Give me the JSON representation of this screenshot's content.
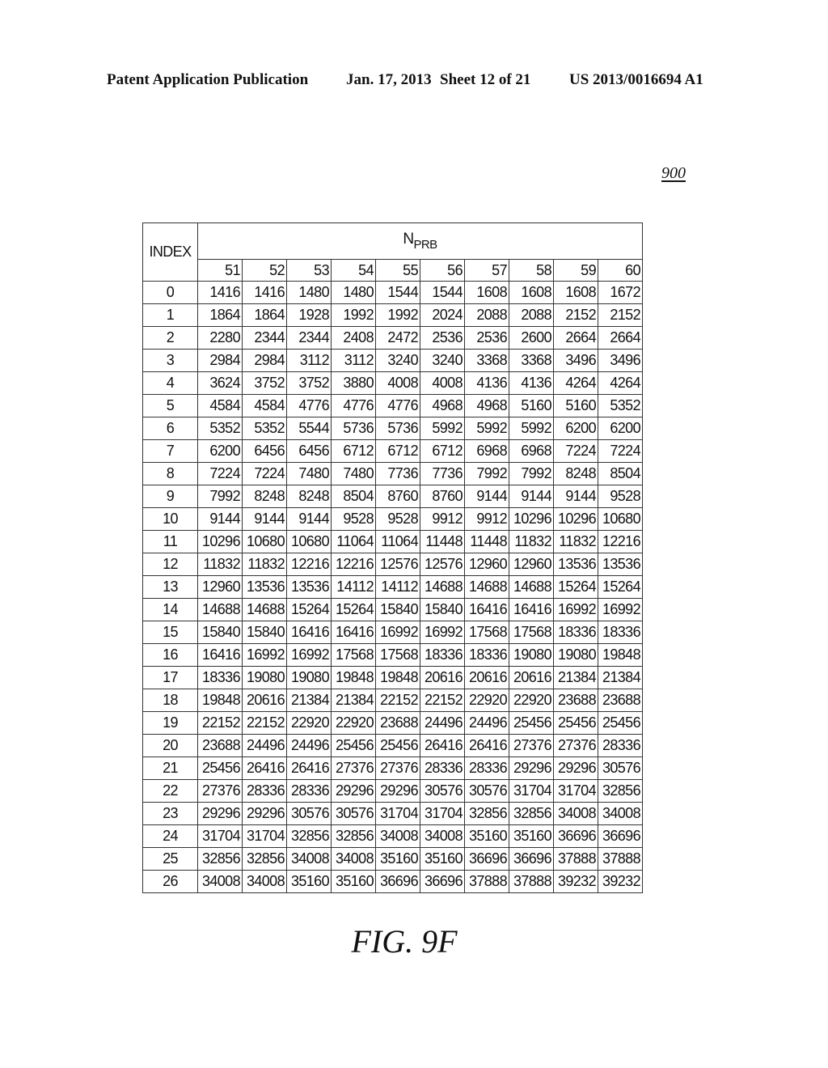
{
  "header": {
    "publication": "Patent Application Publication",
    "date": "Jan. 17, 2013",
    "sheet": "Sheet 12 of 21",
    "number": "US 2013/0016694 A1"
  },
  "figure_ref": "900",
  "table": {
    "index_label": "INDEX",
    "group_label_main": "N",
    "group_label_sub": "PRB",
    "columns": [
      "51",
      "52",
      "53",
      "54",
      "55",
      "56",
      "57",
      "58",
      "59",
      "60"
    ],
    "rows": [
      {
        "index": "0",
        "values": [
          "1416",
          "1416",
          "1480",
          "1480",
          "1544",
          "1544",
          "1608",
          "1608",
          "1608",
          "1672"
        ]
      },
      {
        "index": "1",
        "values": [
          "1864",
          "1864",
          "1928",
          "1992",
          "1992",
          "2024",
          "2088",
          "2088",
          "2152",
          "2152"
        ]
      },
      {
        "index": "2",
        "values": [
          "2280",
          "2344",
          "2344",
          "2408",
          "2472",
          "2536",
          "2536",
          "2600",
          "2664",
          "2664"
        ]
      },
      {
        "index": "3",
        "values": [
          "2984",
          "2984",
          "3112",
          "3112",
          "3240",
          "3240",
          "3368",
          "3368",
          "3496",
          "3496"
        ]
      },
      {
        "index": "4",
        "values": [
          "3624",
          "3752",
          "3752",
          "3880",
          "4008",
          "4008",
          "4136",
          "4136",
          "4264",
          "4264"
        ]
      },
      {
        "index": "5",
        "values": [
          "4584",
          "4584",
          "4776",
          "4776",
          "4776",
          "4968",
          "4968",
          "5160",
          "5160",
          "5352"
        ]
      },
      {
        "index": "6",
        "values": [
          "5352",
          "5352",
          "5544",
          "5736",
          "5736",
          "5992",
          "5992",
          "5992",
          "6200",
          "6200"
        ]
      },
      {
        "index": "7",
        "values": [
          "6200",
          "6456",
          "6456",
          "6712",
          "6712",
          "6712",
          "6968",
          "6968",
          "7224",
          "7224"
        ]
      },
      {
        "index": "8",
        "values": [
          "7224",
          "7224",
          "7480",
          "7480",
          "7736",
          "7736",
          "7992",
          "7992",
          "8248",
          "8504"
        ]
      },
      {
        "index": "9",
        "values": [
          "7992",
          "8248",
          "8248",
          "8504",
          "8760",
          "8760",
          "9144",
          "9144",
          "9144",
          "9528"
        ]
      },
      {
        "index": "10",
        "values": [
          "9144",
          "9144",
          "9144",
          "9528",
          "9528",
          "9912",
          "9912",
          "10296",
          "10296",
          "10680"
        ]
      },
      {
        "index": "11",
        "values": [
          "10296",
          "10680",
          "10680",
          "11064",
          "11064",
          "11448",
          "11448",
          "11832",
          "11832",
          "12216"
        ]
      },
      {
        "index": "12",
        "values": [
          "11832",
          "11832",
          "12216",
          "12216",
          "12576",
          "12576",
          "12960",
          "12960",
          "13536",
          "13536"
        ]
      },
      {
        "index": "13",
        "values": [
          "12960",
          "13536",
          "13536",
          "14112",
          "14112",
          "14688",
          "14688",
          "14688",
          "15264",
          "15264"
        ]
      },
      {
        "index": "14",
        "values": [
          "14688",
          "14688",
          "15264",
          "15264",
          "15840",
          "15840",
          "16416",
          "16416",
          "16992",
          "16992"
        ]
      },
      {
        "index": "15",
        "values": [
          "15840",
          "15840",
          "16416",
          "16416",
          "16992",
          "16992",
          "17568",
          "17568",
          "18336",
          "18336"
        ]
      },
      {
        "index": "16",
        "values": [
          "16416",
          "16992",
          "16992",
          "17568",
          "17568",
          "18336",
          "18336",
          "19080",
          "19080",
          "19848"
        ]
      },
      {
        "index": "17",
        "values": [
          "18336",
          "19080",
          "19080",
          "19848",
          "19848",
          "20616",
          "20616",
          "20616",
          "21384",
          "21384"
        ]
      },
      {
        "index": "18",
        "values": [
          "19848",
          "20616",
          "21384",
          "21384",
          "22152",
          "22152",
          "22920",
          "22920",
          "23688",
          "23688"
        ]
      },
      {
        "index": "19",
        "values": [
          "22152",
          "22152",
          "22920",
          "22920",
          "23688",
          "24496",
          "24496",
          "25456",
          "25456",
          "25456"
        ]
      },
      {
        "index": "20",
        "values": [
          "23688",
          "24496",
          "24496",
          "25456",
          "25456",
          "26416",
          "26416",
          "27376",
          "27376",
          "28336"
        ]
      },
      {
        "index": "21",
        "values": [
          "25456",
          "26416",
          "26416",
          "27376",
          "27376",
          "28336",
          "28336",
          "29296",
          "29296",
          "30576"
        ]
      },
      {
        "index": "22",
        "values": [
          "27376",
          "28336",
          "28336",
          "29296",
          "29296",
          "30576",
          "30576",
          "31704",
          "31704",
          "32856"
        ]
      },
      {
        "index": "23",
        "values": [
          "29296",
          "29296",
          "30576",
          "30576",
          "31704",
          "31704",
          "32856",
          "32856",
          "34008",
          "34008"
        ]
      },
      {
        "index": "24",
        "values": [
          "31704",
          "31704",
          "32856",
          "32856",
          "34008",
          "34008",
          "35160",
          "35160",
          "36696",
          "36696"
        ]
      },
      {
        "index": "25",
        "values": [
          "32856",
          "32856",
          "34008",
          "34008",
          "35160",
          "35160",
          "36696",
          "36696",
          "37888",
          "37888"
        ]
      },
      {
        "index": "26",
        "values": [
          "34008",
          "34008",
          "35160",
          "35160",
          "36696",
          "36696",
          "37888",
          "37888",
          "39232",
          "39232"
        ]
      }
    ]
  },
  "caption": "FIG. 9F"
}
